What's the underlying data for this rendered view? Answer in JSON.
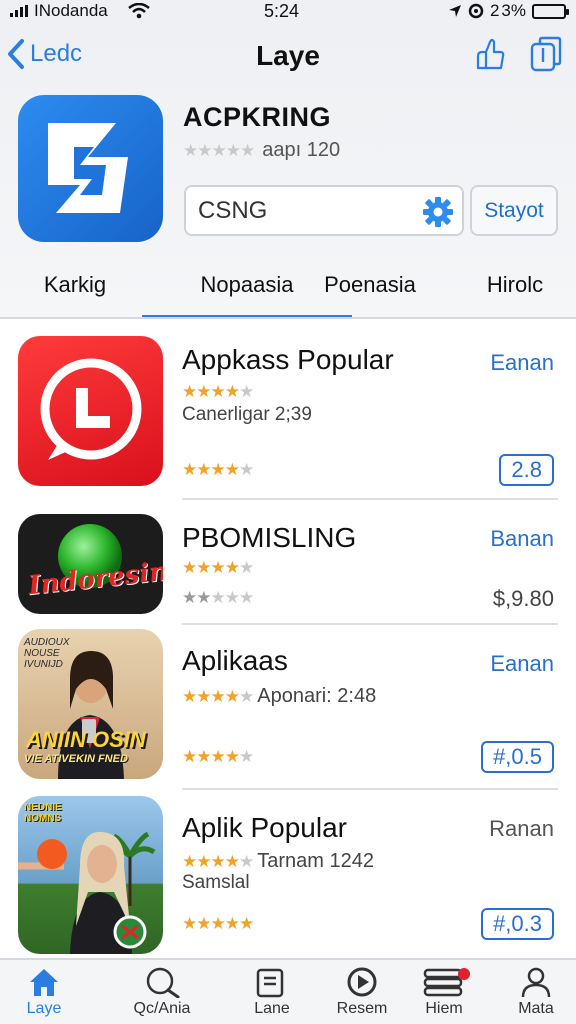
{
  "status": {
    "carrier": "INodanda",
    "time": "5:24",
    "battery": "3%",
    "battery_prefix": "2"
  },
  "nav": {
    "back_label": "Ledc",
    "title": "Laye"
  },
  "app": {
    "title": "ACPKRING",
    "rating_text": "aapı 120",
    "stars": 0
  },
  "search": {
    "value": "CSNG",
    "button_label": "Stayot"
  },
  "tabs": [
    {
      "label": "Karkig"
    },
    {
      "label": "Nopaasia"
    },
    {
      "label": "Poenasia"
    },
    {
      "label": "Hirolc"
    }
  ],
  "list": [
    {
      "name": "Appkass Popular",
      "action": "Eanan",
      "sub": "Canerligar 2;39",
      "rating_text": "",
      "price": "2.8",
      "stars_top": 3.5,
      "stars_bottom": 4
    },
    {
      "name": "PBOMISLING",
      "action": "Banan",
      "sub": "",
      "rating_text": "",
      "price": "$,9.80",
      "stars_top": 3.5,
      "stars_bottom": 1.5,
      "icon_text": "Indoresin"
    },
    {
      "name": "Aplikaas",
      "action": "Eanan",
      "sub": "",
      "rating_text": "Aponari: 2:48",
      "price": "#,0.5",
      "stars_top": 3.5,
      "stars_bottom": 3.5,
      "icon_text_top": "AUDIOUX\nNOUSE\nIVUNIJD",
      "icon_text": "ANIIN OSIN",
      "icon_text_small": "VIE ATIVEKIN FNED"
    },
    {
      "name": "Aplik Popular",
      "action": "Ranan",
      "sub": "Samslal",
      "rating_text": "Tarnam 1242",
      "price": "#,0.3",
      "stars_top": 3.5,
      "stars_bottom": 4.5,
      "icon_text_top": "NEDNIE\nNOMNS"
    }
  ],
  "tabbar": [
    {
      "label": "Laye",
      "icon": "home-icon"
    },
    {
      "label": "Qc/Ania",
      "icon": "search-icon"
    },
    {
      "label": "Lane",
      "icon": "cup-icon"
    },
    {
      "label": "Resem",
      "icon": "play-icon"
    },
    {
      "label": "Hiem",
      "icon": "stack-icon"
    },
    {
      "label": "Mata",
      "icon": "person-icon"
    }
  ],
  "colors": {
    "accent": "#2a7de1",
    "star": "#f2a227",
    "badge": "#e0202a"
  }
}
